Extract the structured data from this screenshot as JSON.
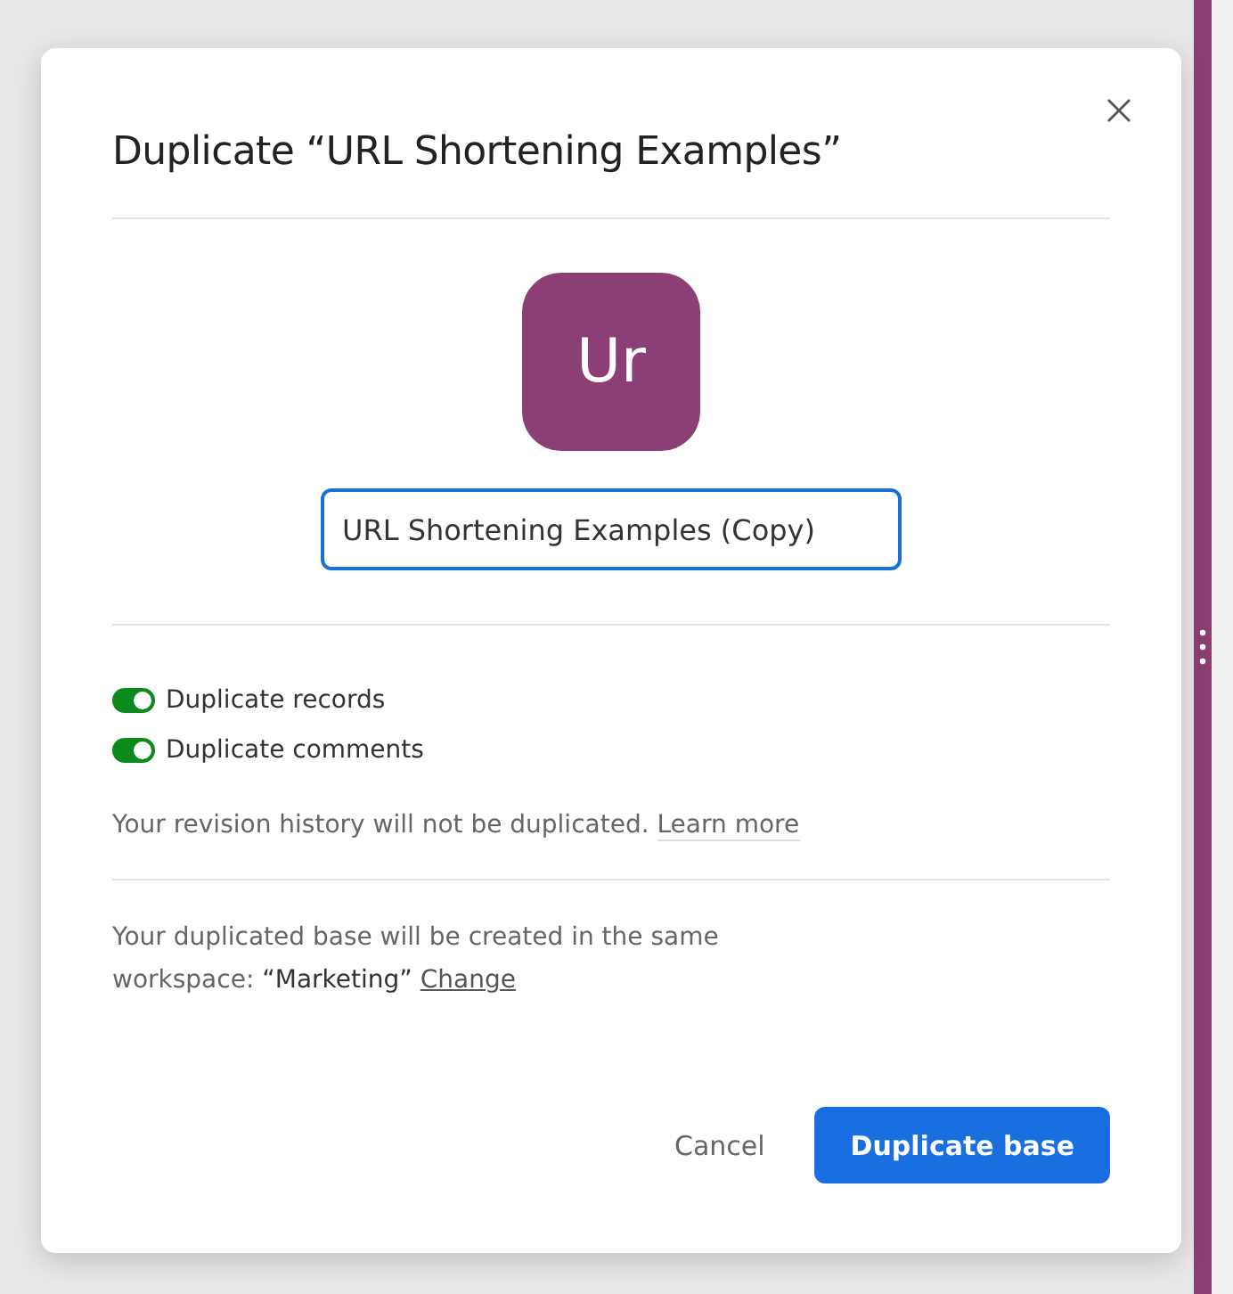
{
  "dialog": {
    "title": "Duplicate “URL Shortening Examples”",
    "avatar": {
      "initials": "Ur",
      "color": "#8b3f74"
    },
    "name_field": {
      "value": "URL Shortening Examples (Copy)",
      "focused": true
    },
    "options": [
      {
        "label": "Duplicate records",
        "on": true
      },
      {
        "label": "Duplicate comments",
        "on": true
      }
    ],
    "revision_note": {
      "text": "Your revision history will not be duplicated.",
      "link": "Learn more"
    },
    "workspace_note": {
      "text": "Your duplicated base will be created in the same workspace:",
      "workspace": "“Marketing”",
      "link": "Change"
    },
    "buttons": {
      "cancel": "Cancel",
      "confirm": "Duplicate base"
    }
  }
}
